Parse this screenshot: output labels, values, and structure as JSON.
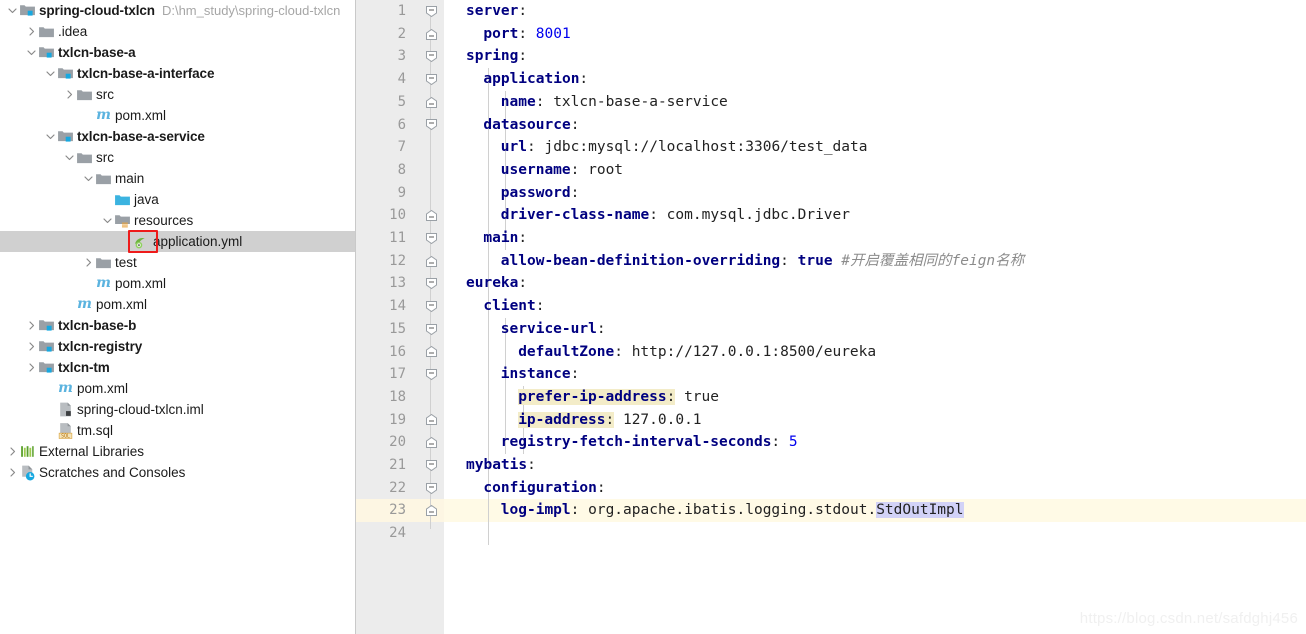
{
  "project_tree": {
    "root_path": "D:\\hm_study\\spring-cloud-txlcn",
    "items": [
      {
        "label": "spring-cloud-txlcn",
        "icon": "module-folder-icon",
        "indent": 0,
        "twisty": "expanded",
        "bold": true,
        "path": "D:\\hm_study\\spring-cloud-txlcn",
        "selected": false
      },
      {
        "label": ".idea",
        "icon": "folder-icon",
        "indent": 1,
        "twisty": "collapsed",
        "bold": false,
        "selected": false
      },
      {
        "label": "txlcn-base-a",
        "icon": "module-folder-icon",
        "indent": 1,
        "twisty": "expanded",
        "bold": true,
        "selected": false
      },
      {
        "label": "txlcn-base-a-interface",
        "icon": "module-folder-icon",
        "indent": 2,
        "twisty": "expanded",
        "bold": true,
        "selected": false
      },
      {
        "label": "src",
        "icon": "folder-icon",
        "indent": 3,
        "twisty": "collapsed",
        "bold": false,
        "selected": false
      },
      {
        "label": "pom.xml",
        "icon": "maven-icon",
        "indent": 4,
        "twisty": "none",
        "bold": false,
        "selected": false
      },
      {
        "label": "txlcn-base-a-service",
        "icon": "module-folder-icon",
        "indent": 2,
        "twisty": "expanded",
        "bold": true,
        "selected": false
      },
      {
        "label": "src",
        "icon": "folder-icon",
        "indent": 3,
        "twisty": "expanded",
        "bold": false,
        "selected": false
      },
      {
        "label": "main",
        "icon": "folder-icon",
        "indent": 4,
        "twisty": "expanded",
        "bold": false,
        "selected": false
      },
      {
        "label": "java",
        "icon": "source-folder-icon",
        "indent": 5,
        "twisty": "none",
        "bold": false,
        "selected": false
      },
      {
        "label": "resources",
        "icon": "resources-folder-icon",
        "indent": 5,
        "twisty": "expanded",
        "bold": false,
        "selected": false
      },
      {
        "label": "application.yml",
        "icon": "spring-yml-icon",
        "indent": 6,
        "twisty": "none",
        "bold": false,
        "selected": true,
        "annotated": true
      },
      {
        "label": "test",
        "icon": "folder-icon",
        "indent": 4,
        "twisty": "collapsed",
        "bold": false,
        "selected": false
      },
      {
        "label": "pom.xml",
        "icon": "maven-icon",
        "indent": 4,
        "twisty": "none",
        "bold": false,
        "selected": false
      },
      {
        "label": "pom.xml",
        "icon": "maven-icon",
        "indent": 3,
        "twisty": "none",
        "bold": false,
        "selected": false
      },
      {
        "label": "txlcn-base-b",
        "icon": "module-folder-icon",
        "indent": 1,
        "twisty": "collapsed",
        "bold": true,
        "selected": false
      },
      {
        "label": "txlcn-registry",
        "icon": "module-folder-icon",
        "indent": 1,
        "twisty": "collapsed",
        "bold": true,
        "selected": false
      },
      {
        "label": "txlcn-tm",
        "icon": "module-folder-icon",
        "indent": 1,
        "twisty": "collapsed",
        "bold": true,
        "selected": false
      },
      {
        "label": "pom.xml",
        "icon": "maven-icon",
        "indent": 2,
        "twisty": "none",
        "bold": false,
        "selected": false
      },
      {
        "label": "spring-cloud-txlcn.iml",
        "icon": "iml-icon",
        "indent": 2,
        "twisty": "none",
        "bold": false,
        "selected": false
      },
      {
        "label": "tm.sql",
        "icon": "sql-icon",
        "indent": 2,
        "twisty": "none",
        "bold": false,
        "selected": false
      },
      {
        "label": "External Libraries",
        "icon": "libraries-icon",
        "indent": 0,
        "twisty": "collapsed",
        "bold": false,
        "selected": false
      },
      {
        "label": "Scratches and Consoles",
        "icon": "scratches-icon",
        "indent": 0,
        "twisty": "collapsed",
        "bold": false,
        "selected": false
      }
    ]
  },
  "editor": {
    "filename": "application.yml",
    "language": "yaml",
    "total_lines": 24,
    "caret_line": 23,
    "lines": [
      {
        "n": 1,
        "fold": "minus-open",
        "indent": 0,
        "tokens": [
          {
            "t": "server",
            "c": "k"
          },
          {
            "t": ":",
            "c": "punct"
          }
        ]
      },
      {
        "n": 2,
        "fold": "minus-end",
        "indent": 1,
        "tokens": [
          {
            "t": "port",
            "c": "k"
          },
          {
            "t": ": ",
            "c": "punct"
          },
          {
            "t": "8001",
            "c": "num"
          }
        ]
      },
      {
        "n": 3,
        "fold": "minus-open",
        "indent": 0,
        "tokens": [
          {
            "t": "spring",
            "c": "k"
          },
          {
            "t": ":",
            "c": "punct"
          }
        ]
      },
      {
        "n": 4,
        "fold": "minus-open",
        "indent": 1,
        "tokens": [
          {
            "t": "application",
            "c": "k"
          },
          {
            "t": ":",
            "c": "punct"
          }
        ]
      },
      {
        "n": 5,
        "fold": "minus-end",
        "indent": 2,
        "tokens": [
          {
            "t": "name",
            "c": "k"
          },
          {
            "t": ": ",
            "c": "punct"
          },
          {
            "t": "txlcn-base-a-service",
            "c": "v"
          }
        ]
      },
      {
        "n": 6,
        "fold": "minus-open",
        "indent": 1,
        "tokens": [
          {
            "t": "datasource",
            "c": "k"
          },
          {
            "t": ":",
            "c": "punct"
          }
        ]
      },
      {
        "n": 7,
        "fold": "none",
        "indent": 2,
        "tokens": [
          {
            "t": "url",
            "c": "k"
          },
          {
            "t": ": ",
            "c": "punct"
          },
          {
            "t": "jdbc:mysql://localhost:3306/test_data",
            "c": "v"
          }
        ]
      },
      {
        "n": 8,
        "fold": "none",
        "indent": 2,
        "tokens": [
          {
            "t": "username",
            "c": "k"
          },
          {
            "t": ": ",
            "c": "punct"
          },
          {
            "t": "root",
            "c": "v"
          }
        ]
      },
      {
        "n": 9,
        "fold": "none",
        "indent": 2,
        "tokens": [
          {
            "t": "password",
            "c": "k"
          },
          {
            "t": ":",
            "c": "punct"
          }
        ]
      },
      {
        "n": 10,
        "fold": "minus-end",
        "indent": 2,
        "tokens": [
          {
            "t": "driver-class-name",
            "c": "k"
          },
          {
            "t": ": ",
            "c": "punct"
          },
          {
            "t": "com.mysql.jdbc.Driver",
            "c": "v"
          }
        ]
      },
      {
        "n": 11,
        "fold": "minus-open",
        "indent": 1,
        "tokens": [
          {
            "t": "main",
            "c": "k"
          },
          {
            "t": ":",
            "c": "punct"
          }
        ]
      },
      {
        "n": 12,
        "fold": "minus-end",
        "indent": 2,
        "tokens": [
          {
            "t": "allow-bean-definition-overriding",
            "c": "k"
          },
          {
            "t": ": ",
            "c": "punct"
          },
          {
            "t": "true",
            "c": "k"
          },
          {
            "t": " ",
            "c": "punct"
          },
          {
            "t": "#开启覆盖相同的feign名称",
            "c": "cmt"
          }
        ]
      },
      {
        "n": 13,
        "fold": "minus-open",
        "indent": 0,
        "tokens": [
          {
            "t": "eureka",
            "c": "k"
          },
          {
            "t": ":",
            "c": "punct"
          }
        ]
      },
      {
        "n": 14,
        "fold": "minus-open",
        "indent": 1,
        "tokens": [
          {
            "t": "client",
            "c": "k"
          },
          {
            "t": ":",
            "c": "punct"
          }
        ]
      },
      {
        "n": 15,
        "fold": "minus-open",
        "indent": 2,
        "tokens": [
          {
            "t": "service-url",
            "c": "k"
          },
          {
            "t": ":",
            "c": "punct"
          }
        ]
      },
      {
        "n": 16,
        "fold": "minus-end",
        "indent": 3,
        "tokens": [
          {
            "t": "defaultZone",
            "c": "k"
          },
          {
            "t": ": ",
            "c": "punct"
          },
          {
            "t": "http://127.0.0.1:8500/eureka",
            "c": "v"
          }
        ]
      },
      {
        "n": 17,
        "fold": "minus-open",
        "indent": 2,
        "tokens": [
          {
            "t": "instance",
            "c": "k"
          },
          {
            "t": ":",
            "c": "punct"
          }
        ]
      },
      {
        "n": 18,
        "fold": "none",
        "indent": 3,
        "tokens": [
          {
            "t": "prefer-ip-address",
            "c": "k hl-key"
          },
          {
            "t": ":",
            "c": "punct hl-key"
          },
          {
            "t": " ",
            "c": "punct"
          },
          {
            "t": "true",
            "c": "v"
          }
        ]
      },
      {
        "n": 19,
        "fold": "minus-end",
        "indent": 3,
        "tokens": [
          {
            "t": "ip-address",
            "c": "k hl-key"
          },
          {
            "t": ":",
            "c": "punct hl-key"
          },
          {
            "t": " ",
            "c": "punct"
          },
          {
            "t": "127.0.0.1",
            "c": "v"
          }
        ]
      },
      {
        "n": 20,
        "fold": "minus-end",
        "indent": 2,
        "tokens": [
          {
            "t": "registry-fetch-interval-seconds",
            "c": "k"
          },
          {
            "t": ": ",
            "c": "punct"
          },
          {
            "t": "5",
            "c": "num"
          }
        ]
      },
      {
        "n": 21,
        "fold": "minus-open",
        "indent": 0,
        "tokens": [
          {
            "t": "mybatis",
            "c": "k"
          },
          {
            "t": ":",
            "c": "punct"
          }
        ]
      },
      {
        "n": 22,
        "fold": "minus-open",
        "indent": 1,
        "tokens": [
          {
            "t": "configuration",
            "c": "k"
          },
          {
            "t": ":",
            "c": "punct"
          }
        ]
      },
      {
        "n": 23,
        "fold": "minus-end",
        "indent": 2,
        "caret": true,
        "tokens": [
          {
            "t": "log-impl",
            "c": "k"
          },
          {
            "t": ": ",
            "c": "punct"
          },
          {
            "t": "org.apache.ibatis.logging.stdout.",
            "c": "v"
          },
          {
            "t": "StdOutImpl",
            "c": "v sel"
          }
        ]
      },
      {
        "n": 24,
        "fold": "none",
        "indent": 0,
        "tokens": []
      }
    ]
  },
  "watermark": {
    "text": "https://blog.csdn.net/safdghj456"
  },
  "colors": {
    "key": "#000080",
    "number": "#0000ee",
    "comment": "#8c8c8c",
    "selection": "#d2d2f7",
    "identifier_highlight": "#f3ecc8",
    "caret_row": "#fffae6",
    "gutter": "#ececec",
    "tree_selection": "#d0d0d0",
    "annotation_box": "#ee1b1b"
  }
}
